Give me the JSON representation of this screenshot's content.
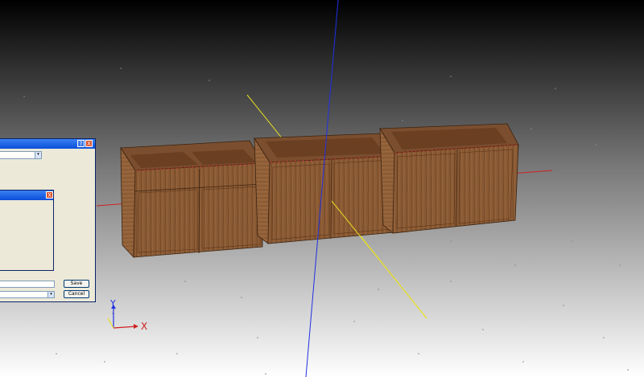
{
  "viewport": {
    "background_top": "#000000",
    "background_bottom": "#ffffff",
    "axis_colors": {
      "x": "#d02020",
      "y": "#2030e0",
      "z": "#e8e020"
    },
    "cabinet_color": "#8a5a34"
  },
  "dialog_main": {
    "help_label": "?",
    "close_label": "X",
    "dropdown_value": "",
    "field_value": "",
    "save_button": "Save",
    "cancel_button": "Cancel"
  },
  "dialog_inner": {
    "close_label": "X"
  },
  "axis_widget": {
    "y_label": "Y",
    "x_label": "X"
  }
}
